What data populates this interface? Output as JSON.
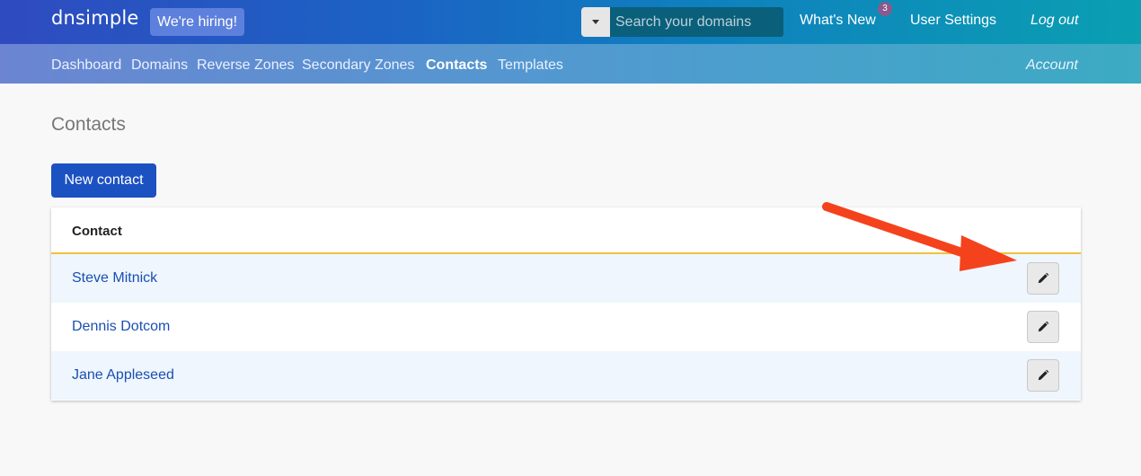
{
  "brand": {
    "logo": "dnsimple",
    "hiring": "We're hiring!"
  },
  "search": {
    "placeholder": "Search your domains"
  },
  "topnav": {
    "whats_new": "What's New",
    "whats_new_count": "3",
    "user_settings": "User Settings",
    "logout": "Log out"
  },
  "subnav": {
    "items": [
      "Dashboard",
      "Domains",
      "Reverse Zones",
      "Secondary Zones",
      "Contacts",
      "Templates"
    ],
    "active": "Contacts",
    "account": "Account"
  },
  "page": {
    "title": "Contacts",
    "new_button": "New contact"
  },
  "table": {
    "header": "Contact",
    "rows": [
      {
        "name": "Steve Mitnick"
      },
      {
        "name": "Dennis Dotcom"
      },
      {
        "name": "Jane Appleseed"
      }
    ]
  },
  "colors": {
    "primary": "#1c51c2",
    "header_rule": "#f0c23c",
    "annotation_arrow": "#f4421d"
  }
}
